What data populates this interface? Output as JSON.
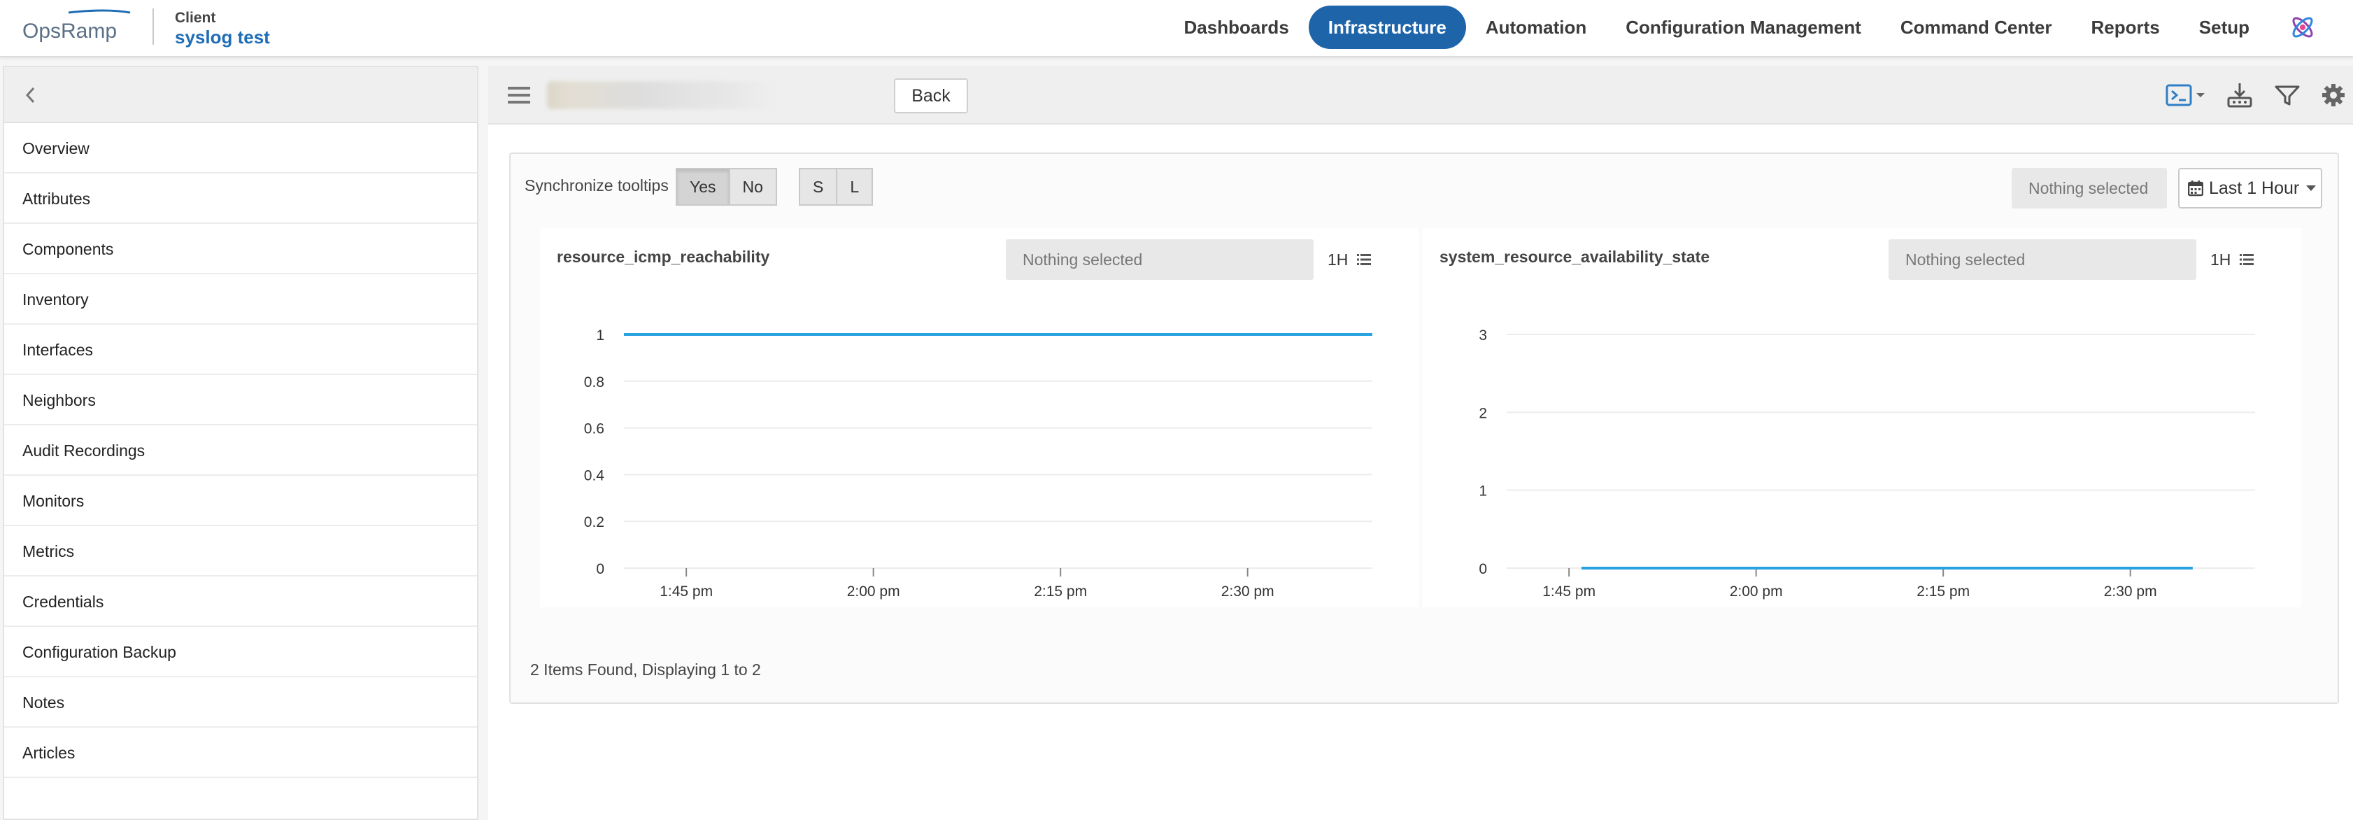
{
  "brand": {
    "name": "OpsRamp",
    "accent": "#1f6db5"
  },
  "client": {
    "label": "Client",
    "name": "syslog test"
  },
  "nav": {
    "items": [
      {
        "label": "Dashboards",
        "active": false
      },
      {
        "label": "Infrastructure",
        "active": true
      },
      {
        "label": "Automation",
        "active": false
      },
      {
        "label": "Configuration Management",
        "active": false
      },
      {
        "label": "Command Center",
        "active": false
      },
      {
        "label": "Reports",
        "active": false
      },
      {
        "label": "Setup",
        "active": false
      }
    ],
    "app_icon": "apps-icon"
  },
  "sidebar": {
    "collapse_icon": "chevron-left-icon",
    "items": [
      "Overview",
      "Attributes",
      "Components",
      "Inventory",
      "Interfaces",
      "Neighbors",
      "Audit Recordings",
      "Monitors",
      "Metrics",
      "Credentials",
      "Configuration Backup",
      "Notes",
      "Articles"
    ]
  },
  "toolbar": {
    "menu_icon": "hamburger-icon",
    "back_label": "Back",
    "icons": [
      "terminal-icon",
      "download-icon",
      "filter-icon",
      "gear-icon"
    ]
  },
  "panel": {
    "sync_label": "Synchronize tooltips",
    "sync_options": [
      "Yes",
      "No"
    ],
    "sync_selected": "Yes",
    "size_options": [
      "S",
      "L"
    ],
    "global_select_placeholder": "Nothing selected",
    "time_range": "Last 1 Hour",
    "time_icon": "calendar-icon",
    "footer": "2 Items Found, Displaying 1 to 2"
  },
  "charts": [
    {
      "title": "resource_icmp_reachability",
      "select_placeholder": "Nothing selected",
      "range": "1H",
      "chart_data": {
        "type": "line",
        "title": "resource_icmp_reachability",
        "x_ticks": [
          "1:45 pm",
          "2:00 pm",
          "2:15 pm",
          "2:30 pm"
        ],
        "y_ticks": [
          "0",
          "0.2",
          "0.4",
          "0.6",
          "0.8",
          "1"
        ],
        "ylim": [
          0,
          1
        ],
        "xlim_minutes_from_140pm": [
          0,
          60
        ],
        "series": [
          {
            "x": [
              "1:40 pm",
              "2:40 pm"
            ],
            "values": [
              1,
              1
            ],
            "color": "#29a3e0"
          }
        ],
        "grid": true
      }
    },
    {
      "title": "system_resource_availability_state",
      "select_placeholder": "Nothing selected",
      "range": "1H",
      "chart_data": {
        "type": "line",
        "title": "system_resource_availability_state",
        "x_ticks": [
          "1:45 pm",
          "2:00 pm",
          "2:15 pm",
          "2:30 pm"
        ],
        "y_ticks": [
          "0",
          "1",
          "2",
          "3"
        ],
        "ylim": [
          0,
          3
        ],
        "series": [
          {
            "x": [
              "1:46 pm",
              "2:35 pm"
            ],
            "values": [
              0,
              0
            ],
            "color": "#29a3e0"
          }
        ],
        "grid": true
      }
    }
  ]
}
